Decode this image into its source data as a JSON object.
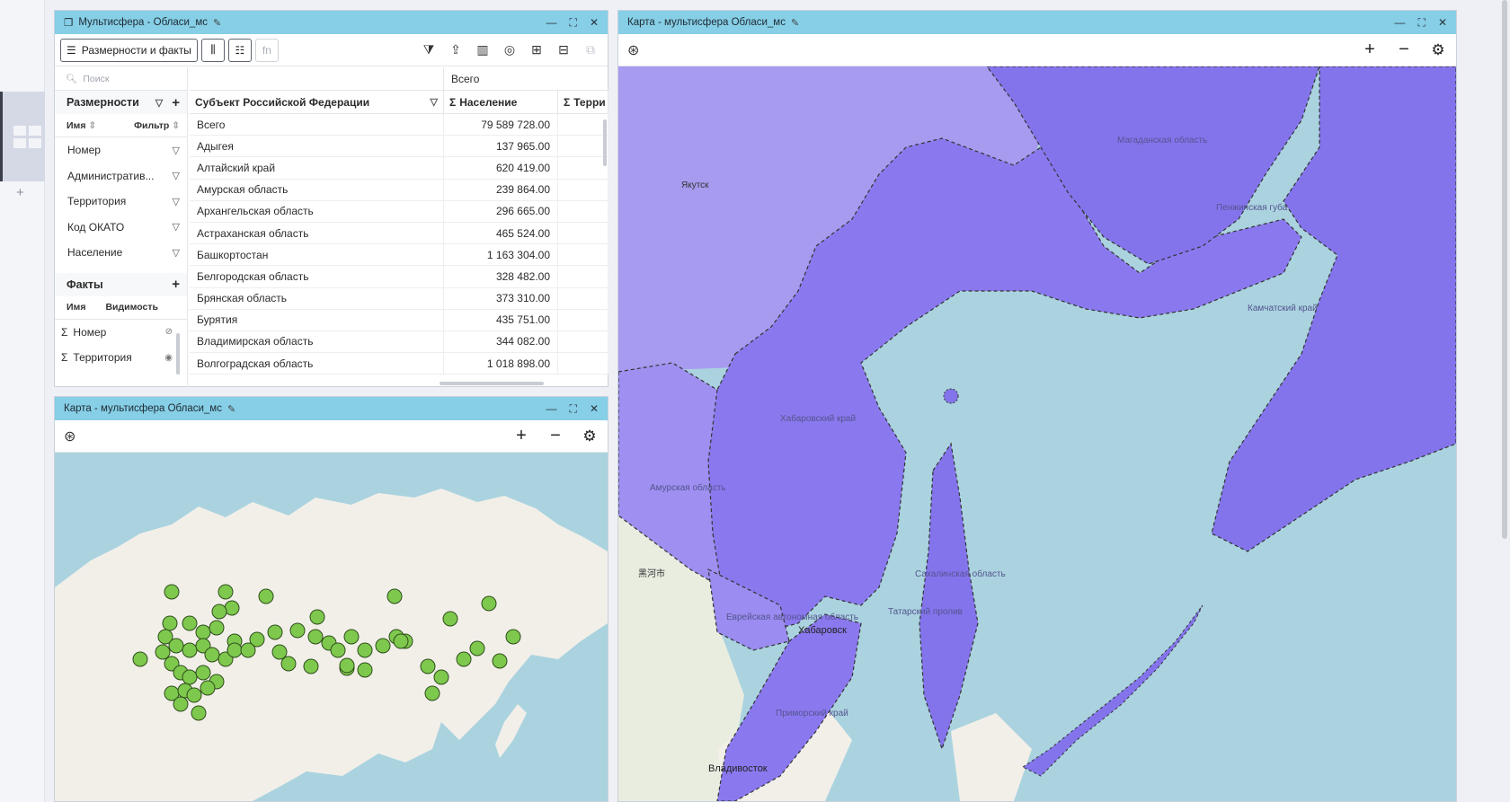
{
  "multisphere": {
    "title": "Мультисфера - Обласи_мс",
    "dims_facts_button": "Размерности и факты",
    "fn_label": "fn",
    "search_placeholder": "Поиск",
    "dimensions_header": "Размерности",
    "dim_col_name": "Имя",
    "dim_col_filter": "Фильтр",
    "dimensions": [
      "Номер",
      "Административ...",
      "Территория",
      "Код ОКАТО",
      "Население"
    ],
    "facts_header": "Факты",
    "fact_col_name": "Имя",
    "fact_col_visibility": "Видимость",
    "facts": [
      "Номер",
      "Территория"
    ],
    "grid": {
      "top_header": "Всего",
      "col_subject": "Субъект Российской Федерации",
      "col_population": "Население",
      "col_territory": "Терри",
      "rows": [
        {
          "name": "Всего",
          "value": "79 589 728.00"
        },
        {
          "name": "Адыгея",
          "value": "137 965.00"
        },
        {
          "name": "Алтайский край",
          "value": "620 419.00"
        },
        {
          "name": "Амурская область",
          "value": "239 864.00"
        },
        {
          "name": "Архангельская область",
          "value": "296 665.00"
        },
        {
          "name": "Астраханская область",
          "value": "465 524.00"
        },
        {
          "name": "Башкортостан",
          "value": "1 163 304.00"
        },
        {
          "name": "Белгородская область",
          "value": "328 482.00"
        },
        {
          "name": "Брянская область",
          "value": "373 310.00"
        },
        {
          "name": "Бурятия",
          "value": "435 751.00"
        },
        {
          "name": "Владимирская область",
          "value": "344 082.00"
        },
        {
          "name": "Волгоградская область",
          "value": "1 018 898.00"
        }
      ]
    }
  },
  "map1": {
    "title": "Карта - мультисфера Обласи_мс"
  },
  "map2": {
    "title": "Карта - мультисфера Обласи_мс",
    "labels": {
      "yakutsk": "Якутск",
      "magadan": "Магаданская область",
      "penzhina": "Пенжинская губа",
      "kamchatka": "Камчатский край",
      "khabarovsk_kray": "Хабаровский край",
      "amur": "Амурская область",
      "heihe": "黑河市",
      "sakhalin": "Сахалинская область",
      "evreyskaya": "Еврейская автономная область",
      "khabarovsk": "Хабаровск",
      "tatar": "Татарский пролив",
      "primorsky": "Приморский край",
      "vladivostok": "Владивосток"
    }
  },
  "colors": {
    "titlebar": "#86cfe6",
    "region_fill": "#8a79ee",
    "sea": "#aad3df",
    "land": "#f2efe9",
    "point": "#7ec94d"
  }
}
